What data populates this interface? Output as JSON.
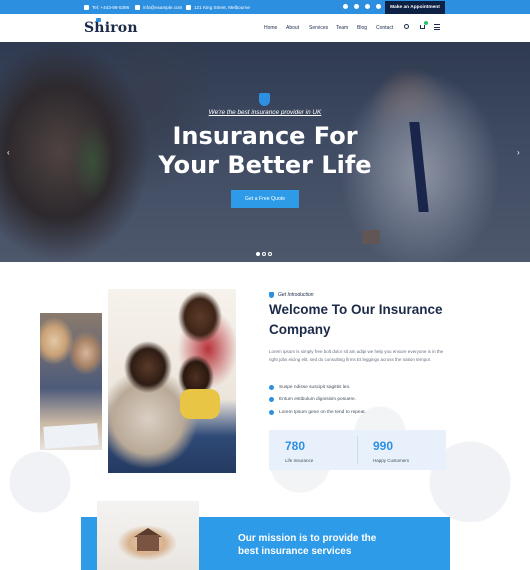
{
  "topbar": {
    "phone": "Tel: +443-98-5396",
    "email": "info@example.com",
    "address": "121 King Street, Melbourne",
    "social_icons": [
      "facebook-icon",
      "twitter-icon",
      "instagram-icon",
      "mail-icon"
    ],
    "appointment_label": "Make an Appointment"
  },
  "header": {
    "logo": "Shiron",
    "nav": [
      "Home",
      "About",
      "Services",
      "Team",
      "Blog",
      "Contact"
    ]
  },
  "hero": {
    "subtitle": "We're the best insurance provider in UK",
    "title_line1": "Insurance For",
    "title_line2": "Your Better Life",
    "cta_label": "Get a Free Quote",
    "prev_arrow": "‹",
    "next_arrow": "›",
    "slide_count": 3,
    "active_slide": 1
  },
  "about": {
    "tag": "Get Introduction",
    "title": "Welcome To Our Insurance Company",
    "body": "Lorem ipsum is simply free bolt dolor sit am adipi we help you ensure everyone is in the right jobs eicing elit, sed do consulting firms Et leggings across the nation tempor.",
    "checks": [
      "Suspe ndisse suscipit sagittis leo.",
      "Entum estibulum dignissim posuere.",
      "Lorem Ipsum gene on the tend to repeat."
    ],
    "stats": [
      {
        "value": "780",
        "label": "Life Insurance"
      },
      {
        "value": "990",
        "label": "Happy Customers"
      }
    ]
  },
  "mission": {
    "text": "Our mission is to provide the best insurance services"
  },
  "colors": {
    "accent": "#2d8fe0",
    "navy": "#0d2145",
    "heading": "#1c2b4a"
  }
}
